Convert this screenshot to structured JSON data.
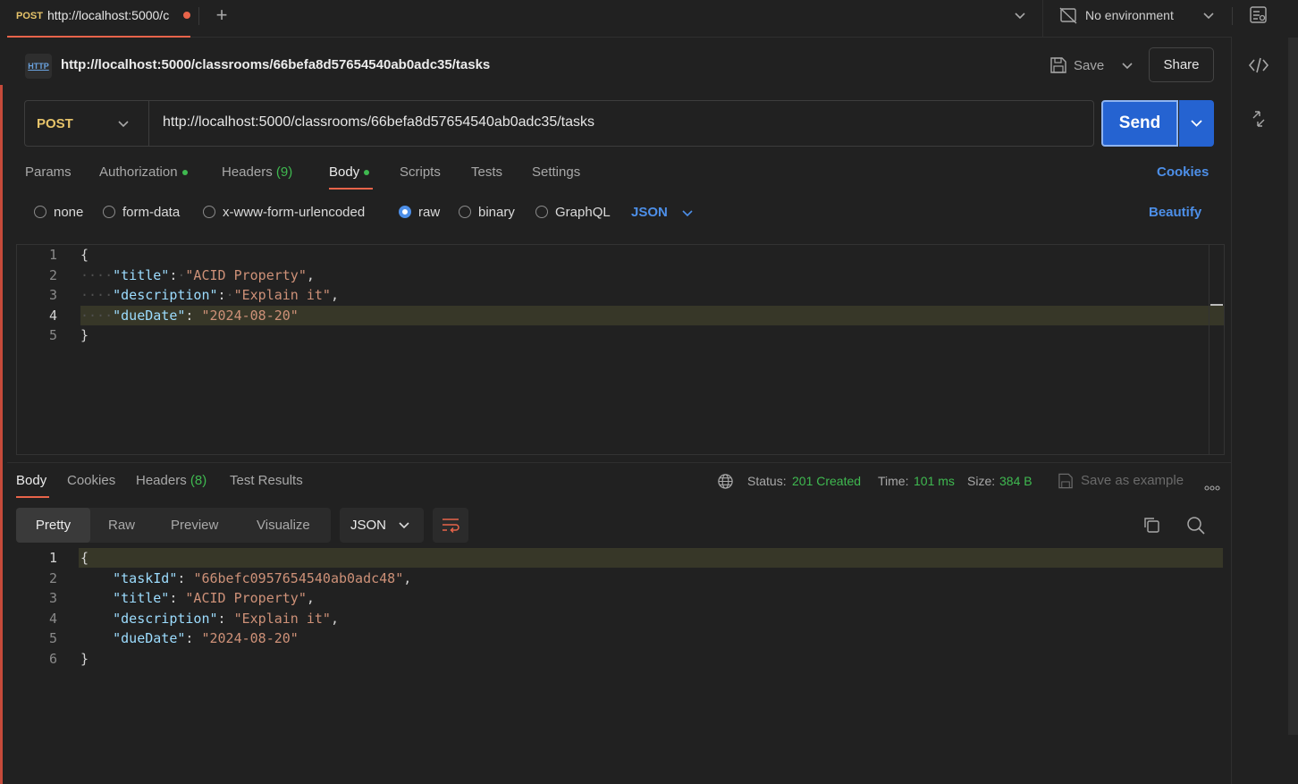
{
  "tab": {
    "method": "POST",
    "url": "http://localhost:5000/c"
  },
  "environment": {
    "label": "No environment"
  },
  "request": {
    "title": "http://localhost:5000/classrooms/66befa8d57654540ab0adc35/tasks",
    "method": "POST",
    "url": "http://localhost:5000/classrooms/66befa8d57654540ab0adc35/tasks",
    "save_label": "Save",
    "share_label": "Share",
    "send_label": "Send",
    "http_icon_label": "HTTP"
  },
  "request_tabs": {
    "params": "Params",
    "authorization": "Authorization",
    "headers": "Headers",
    "headers_count": "(9)",
    "body": "Body",
    "scripts": "Scripts",
    "tests": "Tests",
    "settings": "Settings",
    "cookies": "Cookies"
  },
  "body_types": {
    "none": "none",
    "form_data": "form-data",
    "urlencoded": "x-www-form-urlencoded",
    "raw": "raw",
    "binary": "binary",
    "graphql": "GraphQL",
    "format": "JSON",
    "beautify": "Beautify"
  },
  "request_body": {
    "line_numbers": [
      "1",
      "2",
      "3",
      "4",
      "5"
    ],
    "open_brace": "{",
    "close_brace": "}",
    "k_title": "\"title\"",
    "v_title": "\"ACID Property\"",
    "k_description": "\"description\"",
    "v_description": "\"Explain it\"",
    "k_dueDate": "\"dueDate\"",
    "v_dueDate": "\"2024-08-20\""
  },
  "response_tabs": {
    "body": "Body",
    "cookies": "Cookies",
    "headers": "Headers",
    "headers_count": "(8)",
    "test_results": "Test Results"
  },
  "response_status": {
    "status_label": "Status:",
    "status_value": "201 Created",
    "time_label": "Time:",
    "time_value": "101 ms",
    "size_label": "Size:",
    "size_value": "384 B",
    "save_example": "Save as example"
  },
  "response_view": {
    "pretty": "Pretty",
    "raw": "Raw",
    "preview": "Preview",
    "visualize": "Visualize",
    "format": "JSON"
  },
  "response_body": {
    "line_numbers": [
      "1",
      "2",
      "3",
      "4",
      "5",
      "6"
    ],
    "open_brace": "{",
    "close_brace": "}",
    "k_taskId": "\"taskId\"",
    "v_taskId": "\"66befc0957654540ab0adc48\"",
    "k_title": "\"title\"",
    "v_title": "\"ACID Property\"",
    "k_description": "\"description\"",
    "v_description": "\"Explain it\"",
    "k_dueDate": "\"dueDate\"",
    "v_dueDate": "\"2024-08-20\""
  },
  "colors": {
    "accent": "#e8644a",
    "send": "#2563d1",
    "link": "#4d8fe8",
    "success": "#3fb950",
    "method": "#e7c46a"
  }
}
